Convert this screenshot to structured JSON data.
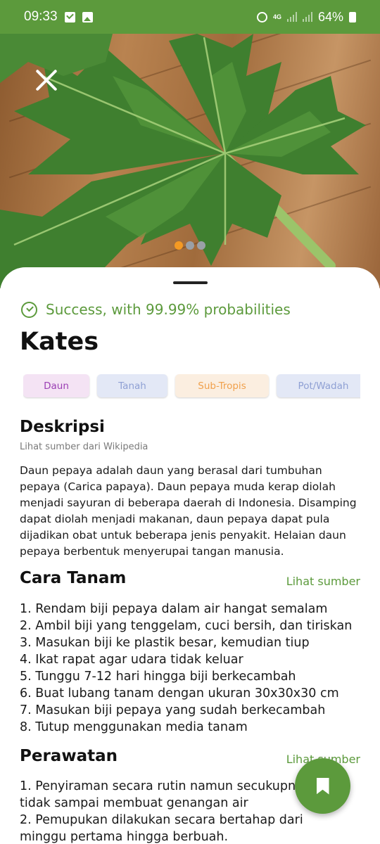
{
  "status_bar": {
    "time": "09:33",
    "network": "4G",
    "battery": "64%",
    "icons": [
      "check-box-icon",
      "gallery-icon",
      "alarm-icon",
      "signal-icon",
      "battery-icon"
    ]
  },
  "hero": {
    "image": "papaya-leaf-photo",
    "close_icon": "close-icon",
    "carousel_active_index": 0,
    "carousel_count": 3
  },
  "result": {
    "success_text": "Success, with 99.99% probabilities",
    "plant_name": "Kates"
  },
  "tags": [
    {
      "label": "Daun",
      "bg": "#f4e3f4",
      "color": "#9b3fb4"
    },
    {
      "label": "Tanah",
      "bg": "#e3e8f6",
      "color": "#8fa0d4"
    },
    {
      "label": "Sub-Tropis",
      "bg": "#fbeee0",
      "color": "#f0a04b"
    },
    {
      "label": "Pot/Wadah",
      "bg": "#e3e8f6",
      "color": "#8fa0d4"
    }
  ],
  "description": {
    "title": "Deskripsi",
    "source_link": "Lihat sumber dari Wikipedia",
    "text": "Daun pepaya adalah daun yang berasal dari tumbuhan pepaya (Carica papaya). Daun pepaya muda kerap diolah menjadi sayuran di beberapa daerah di Indonesia. Disamping dapat diolah menjadi makanan, daun pepaya dapat pula dijadikan obat untuk beberapa jenis penyakit. Helaian daun pepaya berbentuk menyerupai tangan manusia."
  },
  "planting": {
    "title": "Cara Tanam",
    "source_link": "Lihat sumber",
    "steps": [
      "1. Rendam biji pepaya dalam air hangat semalam",
      "2. Ambil biji yang tenggelam, cuci bersih, dan tiriskan",
      "3. Masukan biji ke plastik besar, kemudian tiup",
      "4. Ikat rapat agar udara tidak keluar",
      "5. Tunggu 7-12 hari hingga biji berkecambah",
      "6. Buat lubang tanam dengan ukuran 30x30x30 cm",
      "7. Masukan biji pepaya yang sudah berkecambah",
      "8. Tutup menggunakan media tanam"
    ]
  },
  "care": {
    "title": "Perawatan",
    "source_link": "Lihat sumber",
    "steps": [
      "1. Penyiraman secara rutin namun secukupnya tidak sampai membuat genangan air",
      "2. Pemupukan dilakukan secara bertahap dari minggu pertama hingga berbuah."
    ]
  },
  "fab": {
    "icon": "bookmark-icon"
  },
  "colors": {
    "accent": "#5c9a3c",
    "carousel_active": "#f59a23"
  }
}
